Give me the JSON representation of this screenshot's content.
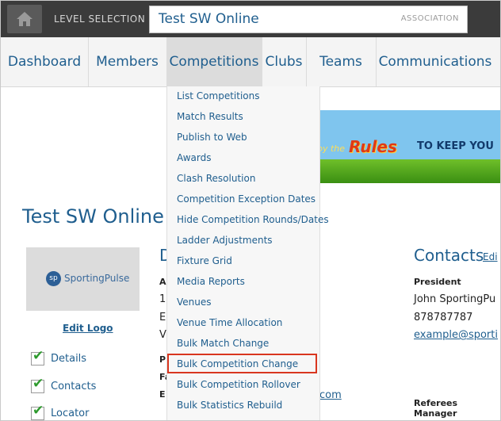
{
  "header": {
    "level_selection_label": "LEVEL SELECTION",
    "level_name": "Test SW Online",
    "level_type": "ASSOCIATION"
  },
  "nav": {
    "items": [
      {
        "label": "Dashboard"
      },
      {
        "label": "Members"
      },
      {
        "label": "Competitions"
      },
      {
        "label": "Clubs"
      },
      {
        "label": "Teams"
      },
      {
        "label": "Communications"
      }
    ],
    "active": "Competitions"
  },
  "competitions_menu": {
    "items": [
      "List Competitions",
      "Match Results",
      "Publish to Web",
      "Awards",
      "Clash Resolution",
      "Competition Exception Dates",
      "Hide Competition Rounds/Dates",
      "Ladder Adjustments",
      "Fixture Grid",
      "Media Reports",
      "Venues",
      "Venue Time Allocation",
      "Bulk Match Change",
      "Bulk Competition Change",
      "Bulk Competition Rollover",
      "Bulk Statistics Rebuild"
    ],
    "highlighted": "Bulk Competition Change"
  },
  "banner": {
    "prefix_text": "by the",
    "rules_text": "Rules",
    "tagline": "TO KEEP YOU"
  },
  "page": {
    "org_title": "Test SW Online",
    "logo_initials": "sp",
    "logo_text": "SportingPulse",
    "edit_logo": "Edit Logo",
    "checklist": [
      "Details",
      "Contacts",
      "Locator"
    ],
    "details_heading_partial": "D",
    "partial_letters": [
      "A",
      "1",
      "E",
      "V",
      "P",
      "Fa",
      "E"
    ],
    "email_partial": "com"
  },
  "contacts": {
    "heading": "Contacts",
    "edit": "Edi",
    "president_role": "President",
    "president_name": "John SportingPu",
    "president_phone": "878787787",
    "president_email": "example@sporti",
    "referees_role": "Referees Manager"
  },
  "colors": {
    "accent": "#1f5e8e",
    "topbar": "#3b3b3b",
    "highlight": "#d9361f"
  }
}
